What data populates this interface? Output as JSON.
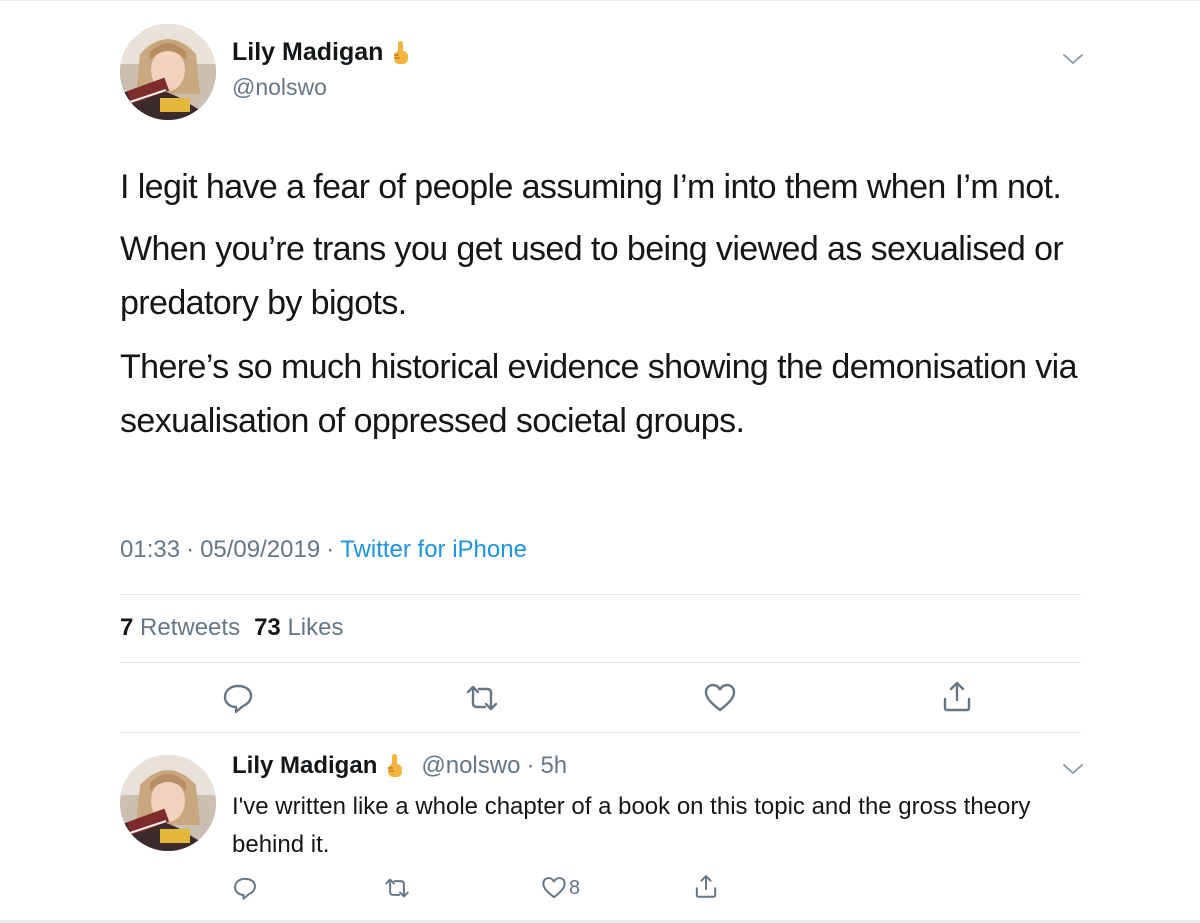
{
  "main_tweet": {
    "display_name": "Lily Madigan",
    "handle": "@nolswo",
    "paragraphs": [
      "I legit have a fear of people assuming I’m into them when I’m not.",
      "When you’re trans you get used to being viewed as sexualised or predatory by bigots.",
      "There’s so much historical evidence showing the demonisation via sexualisation of oppressed societal groups."
    ],
    "time": "01:33",
    "date": "05/09/2019",
    "meta_separator": "·",
    "source": "Twitter for iPhone",
    "retweets_count": "7",
    "retweets_label": "Retweets",
    "likes_count": "73",
    "likes_label": "Likes"
  },
  "reply_tweet": {
    "display_name": "Lily Madigan",
    "handle": "@nolswo",
    "time_sep": "·",
    "time_ago": "5h",
    "text": "I've written like a whole chapter of a book on this topic and the gross theory behind it.",
    "like_count": "8"
  },
  "icons": {
    "name_emoji": "index-pointing-up-emoji",
    "menu": "chevron-down-icon",
    "reply": "reply-icon",
    "retweet": "retweet-icon",
    "like": "heart-icon",
    "share": "share-icon"
  },
  "colors": {
    "text": "#14171a",
    "secondary": "#657786",
    "link": "#1b95e0",
    "divider": "#e1e8ed"
  }
}
